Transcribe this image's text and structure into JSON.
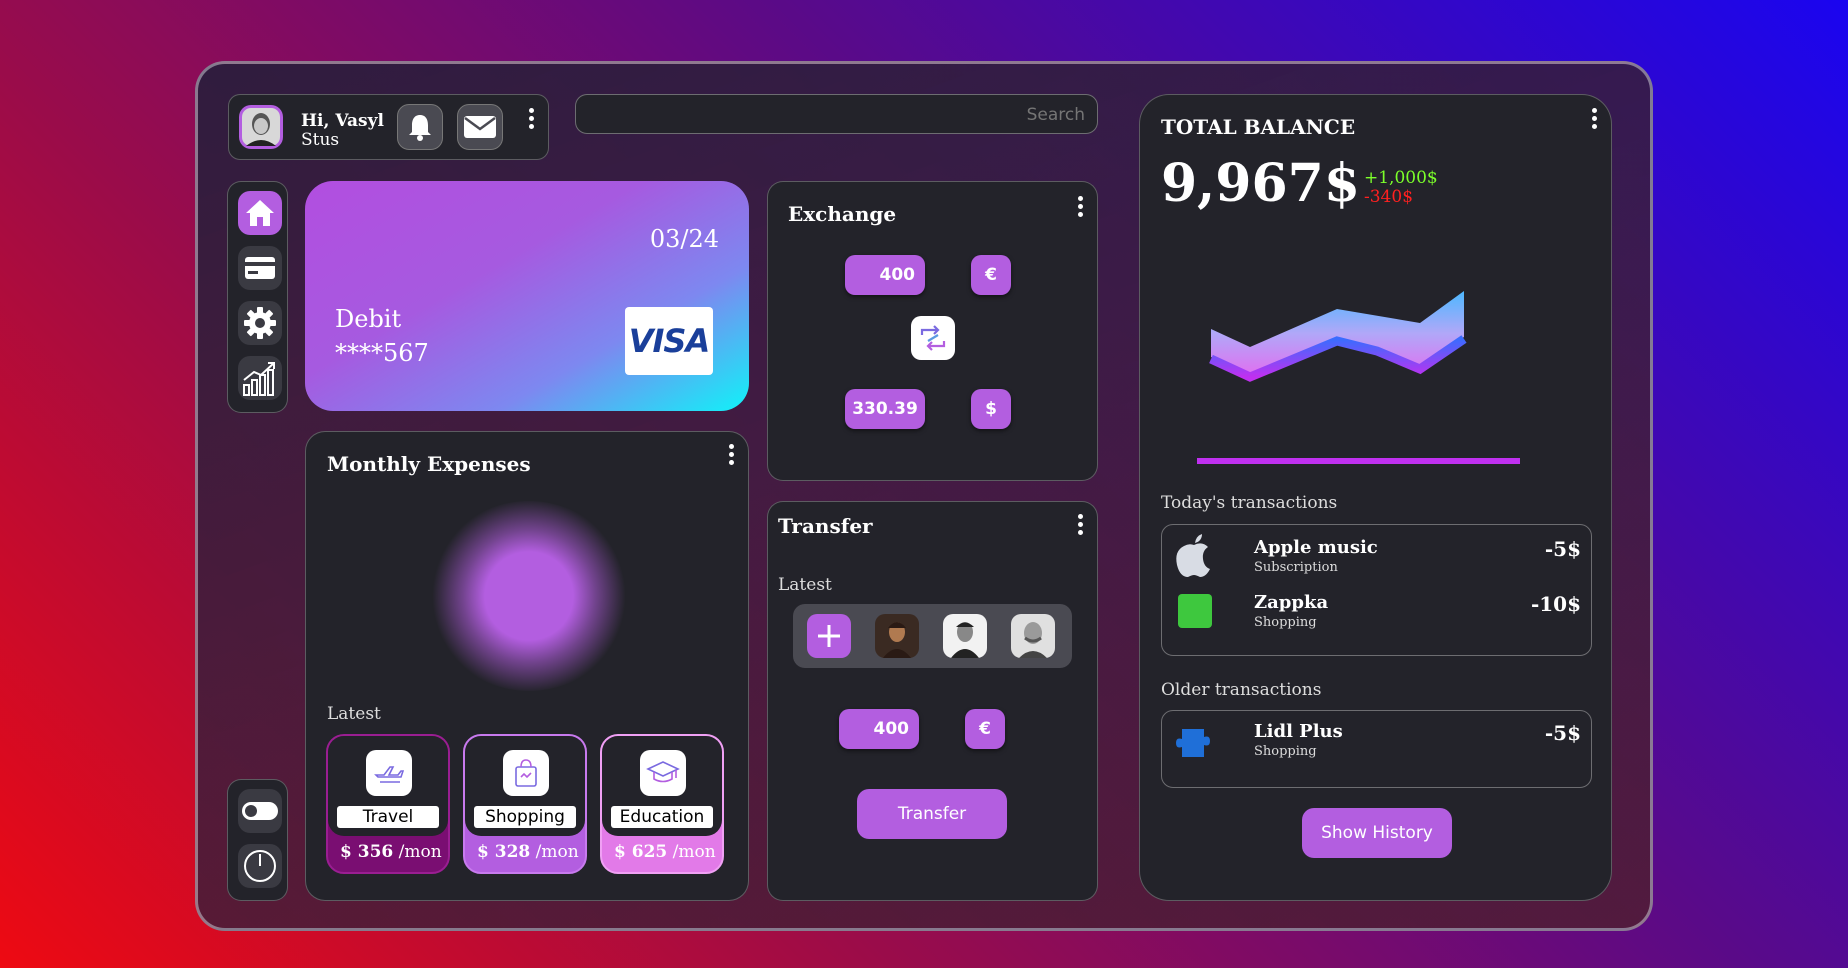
{
  "user": {
    "greeting": "Hi, Vasyl",
    "surname": "Stus"
  },
  "search": {
    "placeholder": "Search"
  },
  "nav": {
    "items": [
      "home",
      "card",
      "settings",
      "analytics"
    ],
    "bottom": [
      "toggle",
      "power"
    ]
  },
  "card": {
    "expiry": "03/24",
    "type": "Debit",
    "number": "****567",
    "brand": "VISA"
  },
  "expenses": {
    "title": "Monthly Expenses",
    "latest_label": "Latest",
    "categories": [
      {
        "name": "Travel",
        "amount": "$ 356",
        "period": "/mon",
        "color": "#7a0e72"
      },
      {
        "name": "Shopping",
        "amount": "$ 328",
        "period": "/mon",
        "color": "#b35ee0"
      },
      {
        "name": "Education",
        "amount": "$ 625",
        "period": "/mon",
        "color": "#e27ae8"
      }
    ]
  },
  "exchange": {
    "title": "Exchange",
    "from_amount": "400",
    "from_currency": "€",
    "to_amount": "330.39",
    "to_currency": "$"
  },
  "transfer": {
    "title": "Transfer",
    "latest_label": "Latest",
    "amount": "400",
    "currency": "€",
    "button": "Transfer"
  },
  "balance": {
    "title": "TOTAL BALANCE",
    "amount": "9,967$",
    "plus": "+1,000$",
    "minus": "-340$",
    "today_label": "Today's transactions",
    "older_label": "Older transactions",
    "today": [
      {
        "name": "Apple music",
        "sub": "Subscription",
        "amount": "-5$",
        "icon": "apple-icon"
      },
      {
        "name": "Zappka",
        "sub": "Shopping",
        "amount": "-10$",
        "icon": "zappka-icon"
      }
    ],
    "older": [
      {
        "name": "Lidl Plus",
        "sub": "Shopping",
        "amount": "-5$",
        "icon": "puzzle-icon"
      }
    ],
    "history_button": "Show History"
  },
  "colors": {
    "accent": "#b35ee0",
    "positive": "#7cff2a",
    "negative": "#ff2020",
    "panel": "#23232a"
  }
}
